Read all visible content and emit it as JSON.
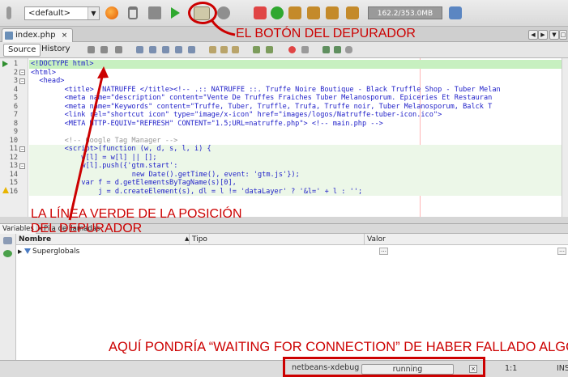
{
  "toolbar": {
    "config_value": "<default>",
    "memory_label": "162.2/353.0MB",
    "icons": [
      "app-icon",
      "config-dropdown-icon",
      "browser-icon",
      "clean-build-icon",
      "build-icon",
      "run-icon",
      "debug-project-icon",
      "profile-icon",
      "stop-icon",
      "continue-icon",
      "step-over-icon",
      "step-into-icon",
      "step-out-icon",
      "run-to-cursor-icon",
      "gc-icon"
    ]
  },
  "file_tab": {
    "label": "index.php"
  },
  "editor_toolbar": {
    "source_label": "Source",
    "history_label": "History"
  },
  "editor": {
    "lines": [
      {
        "n": "1",
        "text": "<!DOCTYPE html>"
      },
      {
        "n": "2",
        "text": "<html>"
      },
      {
        "n": "3",
        "text": "<head>"
      },
      {
        "n": "4",
        "text": "<title>  NATRUFFE </title><!-- .:: NATRUFFE ::. Truffe Noire Boutique - Black Truffle Shop - Tuber Melan"
      },
      {
        "n": "5",
        "text": "<meta name=\"description\" content=\"Vente De Truffes Fraiches Tuber Melanosporum. Epiceries Et Restauran"
      },
      {
        "n": "6",
        "text": "<meta name=\"Keywords\" content=\"Truffe, Tuber, Truffle, Trufa, Truffe noir, Tuber Melanosporum, Balck T"
      },
      {
        "n": "7",
        "text": "<link rel=\"shortcut icon\" type=\"image/x-icon\" href=\"images/logos/Natruffe-tuber-icon.ico\">"
      },
      {
        "n": "8",
        "text": "<META HTTP-EQUIV=\"REFRESH\" CONTENT=\"1.5;URL=natruffe.php\"> <!-- main.php -->"
      },
      {
        "n": "9",
        "text": ""
      },
      {
        "n": "10",
        "text": "<!-- Google Tag Manager -->"
      },
      {
        "n": "11",
        "text": "<script>(function (w, d, s, l, i) {"
      },
      {
        "n": "12",
        "text": "w[l] = w[l] || [];"
      },
      {
        "n": "13",
        "text": "w[l].push({'gtm.start':"
      },
      {
        "n": "14",
        "text": "new Date().getTime(), event: 'gtm.js'});"
      },
      {
        "n": "15",
        "text": "var f = d.getElementsByTagName(s)[0],"
      },
      {
        "n": "16",
        "text": "j = d.createElement(s), dl = l != 'dataLayer' ? '&l=' + l : '';"
      }
    ]
  },
  "variables_panel": {
    "tab_variables": "Variables",
    "tab_callstack": "Pila de llamadas",
    "col_name": "Nombre",
    "col_type": "Tipo",
    "col_value": "Valor",
    "rows": [
      {
        "name": "Superglobals",
        "type": "",
        "value": ""
      }
    ]
  },
  "status_bar": {
    "process": "netbeans-xdebug",
    "state": "running",
    "position": "1:1",
    "mode": "INS"
  },
  "annotations": {
    "debugger_button": "EL BOTÓN DEL DEPURADOR",
    "green_line_1": "LA LÍNEA VERDE DE LA POSICIÓN",
    "green_line_2": "DEL DEPURADOR",
    "waiting": "AQUÍ PONDRÍA “WAITING FOR CONNECTION” DE HABER FALLADO ALGO",
    "color": "#cc0000"
  }
}
